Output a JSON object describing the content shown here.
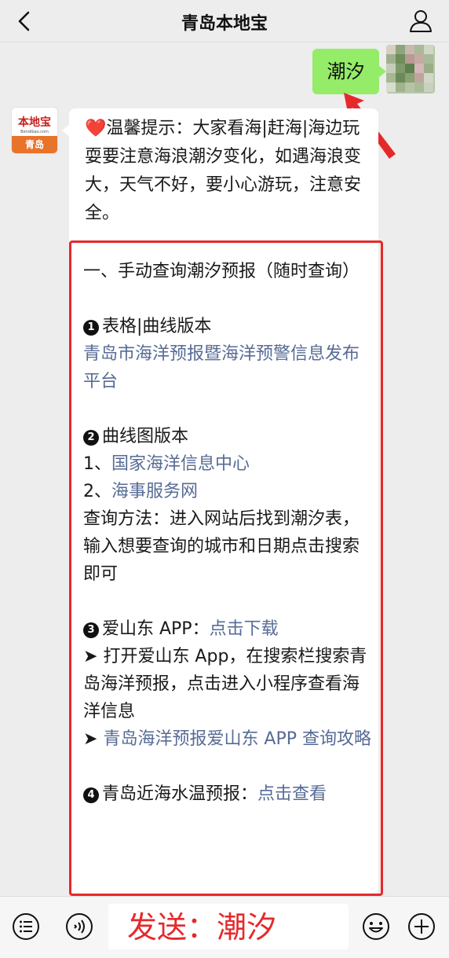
{
  "header": {
    "title": "青岛本地宝",
    "back_icon": "chevron-left-icon",
    "profile_icon": "person-icon"
  },
  "chat": {
    "sent_message": "潮汐",
    "bot_avatar": {
      "logo_text": "本地宝",
      "logo_url": "Bendibao.com",
      "logo_city": "青岛"
    },
    "tip": {
      "heart": "❤️",
      "text": "温馨提示：大家看海|赶海|海边玩耍要注意海浪潮汐变化，如遇海浪变大，天气不好，要小心游玩，注意安全。"
    },
    "section_title": "一、手动查询潮汐预报（随时查询）",
    "item1": {
      "num": "1",
      "label": "表格|曲线版本",
      "link": "青岛市海洋预报暨海洋预警信息发布平台"
    },
    "item2": {
      "num": "2",
      "label": "曲线图版本",
      "sub1_prefix": "1、",
      "sub1_link": "国家海洋信息中心",
      "sub2_prefix": "2、",
      "sub2_link": "海事服务网",
      "method": "查询方法：进入网站后找到潮汐表，输入想要查询的城市和日期点击搜索即可"
    },
    "item3": {
      "num": "3",
      "label": "爱山东 APP：",
      "download_link": "点击下载",
      "bullet": "➤",
      "step_text": "打开爱山东 App，在搜索栏搜索青岛海洋预报，点击进入小程序查看海洋信息",
      "guide_link": "青岛海洋预报爱山东 APP 查询攻略"
    },
    "item4": {
      "num": "4",
      "label": "青岛近海水温预报：",
      "link": "点击查看"
    }
  },
  "bottom_bar": {
    "menu_icon": "list-menu-icon",
    "voice_icon": "voice-icon",
    "input_text": "发送：潮汐",
    "emoji_icon": "emoji-icon",
    "plus_icon": "plus-icon"
  },
  "colors": {
    "sent_bubble": "#95ec69",
    "link": "#576b95",
    "highlight": "#e5292b"
  }
}
